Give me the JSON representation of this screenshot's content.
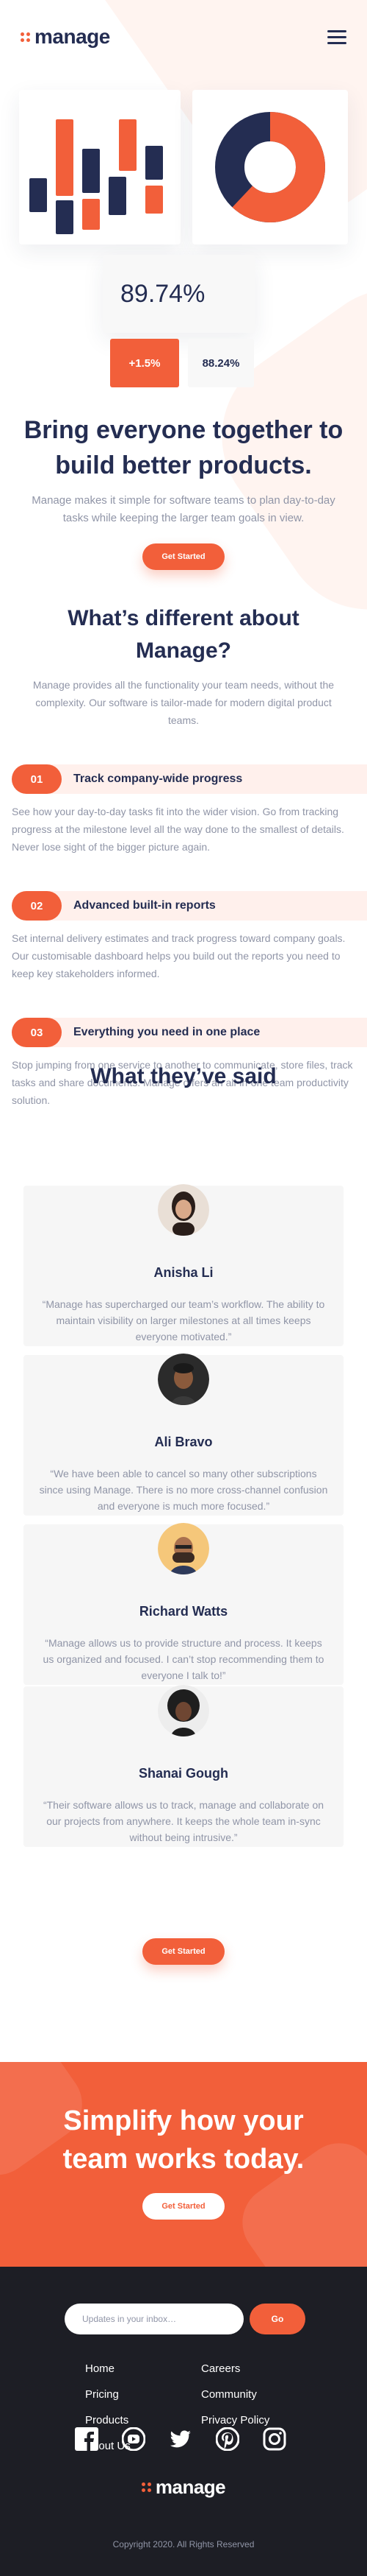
{
  "header": {
    "logo_text": "manage",
    "menu_icon": "hamburger-menu-icon"
  },
  "hero": {
    "chart_percent": "89.74%",
    "stat_change": "+1.5%",
    "stat_secondary": "88.24%",
    "donut_value": 0.62,
    "title": "Bring everyone together to build better products.",
    "text": "Manage makes it simple for software teams to plan day-to-day tasks while keeping the larger team goals in view.",
    "cta_label": "Get Started"
  },
  "different": {
    "title": "What’s different about Manage?",
    "text": "Manage provides all the functionality your team needs, without the complexity. Our software is tailor-made for modern digital product teams.",
    "features": [
      {
        "num": "01",
        "title": "Track company-wide progress",
        "text": "See how your day-to-day tasks fit into the wider vision. Go from tracking progress at the milestone level all the way done to the smallest of details. Never lose sight of the bigger picture again."
      },
      {
        "num": "02",
        "title": "Advanced built-in reports",
        "text": "Set internal delivery estimates and track progress toward company goals. Our customisable dashboard helps you build out the reports you need to keep key stakeholders informed."
      },
      {
        "num": "03",
        "title": "Everything you need in one place",
        "text": "Stop jumping from one service to another to communicate, store files, track tasks and share documents. Manage offers an all-in-one team productivity solution."
      }
    ]
  },
  "testimonials": {
    "title": "What they’ve said",
    "items": [
      {
        "name": "Anisha Li",
        "quote": "“Manage has supercharged our team’s workflow. The ability to maintain visibility on larger milestones at all times keeps everyone motivated.”"
      },
      {
        "name": "Ali Bravo",
        "quote": "“We have been able to cancel so many other subscriptions since using Manage. There is no more cross-channel confusion and everyone is much more focused.”"
      },
      {
        "name": "Richard Watts",
        "quote": "“Manage allows us to provide structure and process. It keeps us organized and focused. I can’t stop recommending them to everyone I talk to!”"
      },
      {
        "name": "Shanai Gough",
        "quote": "“Their software allows us to track, manage and collaborate on our projects from anywhere. It keeps the whole team in-sync without being intrusive.”"
      }
    ],
    "cta_label": "Get Started"
  },
  "cta": {
    "title": "Simplify how your team works today.",
    "button_label": "Get Started"
  },
  "footer": {
    "newsletter_placeholder": "Updates in your inbox…",
    "go_label": "Go",
    "links": [
      "Home",
      "Careers",
      "Pricing",
      "Community",
      "Products",
      "Privacy Policy",
      "About Us"
    ],
    "socials": [
      "facebook-icon",
      "youtube-icon",
      "twitter-icon",
      "pinterest-icon",
      "instagram-icon"
    ],
    "logo_text": "manage",
    "copyright": "Copyright 2020. All Rights Reserved"
  },
  "colors": {
    "accent": "#F25F3A",
    "navy": "#242D52",
    "muted": "#9095A7",
    "footer_bg": "#1D1E25",
    "tint": "#FFF0EC"
  }
}
